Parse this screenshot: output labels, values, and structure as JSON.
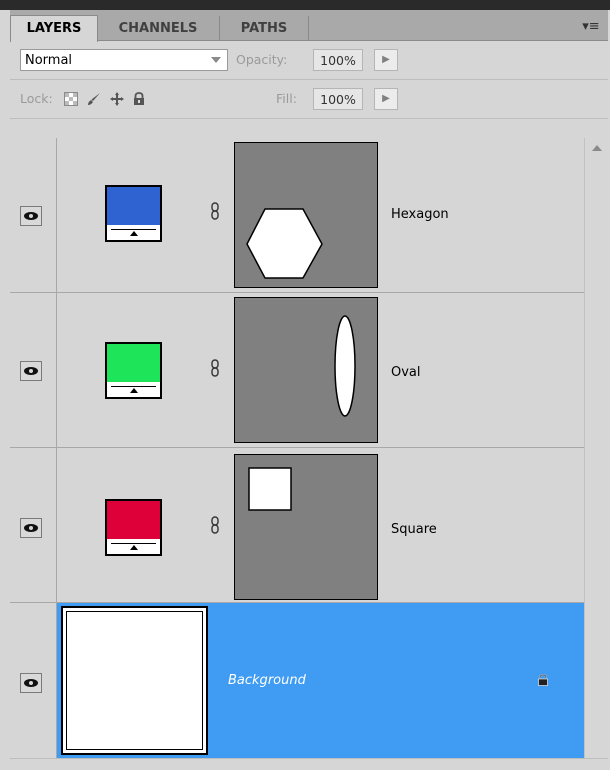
{
  "tabs": [
    {
      "label": "LAYERS",
      "active": true
    },
    {
      "label": "CHANNELS",
      "active": false
    },
    {
      "label": "PATHS",
      "active": false
    }
  ],
  "panel_menu_icon": "panel-menu-icon",
  "blend_mode": {
    "value": "Normal"
  },
  "opacity": {
    "label": "Opacity:",
    "value": "100%"
  },
  "lock": {
    "label": "Lock:",
    "icons": [
      "lock-transparent-pixels-icon",
      "lock-image-pixels-icon",
      "lock-position-icon",
      "lock-all-icon"
    ]
  },
  "fill": {
    "label": "Fill:",
    "value": "100%"
  },
  "layers": [
    {
      "name": "Hexagon",
      "color": "#2f63d2",
      "mask_shape": "hexagon",
      "visible": true,
      "selected": false
    },
    {
      "name": "Oval",
      "color": "#1ee45a",
      "mask_shape": "ellipse",
      "visible": true,
      "selected": false
    },
    {
      "name": "Square",
      "color": "#dd0039",
      "mask_shape": "square",
      "visible": true,
      "selected": false
    },
    {
      "name": "Background",
      "color": "#ffffff",
      "locked": true,
      "visible": true,
      "selected": true
    }
  ],
  "colors": {
    "selection": "#3f9cf2",
    "panel_bg": "#d6d6d6",
    "mask_bg": "#808080"
  }
}
